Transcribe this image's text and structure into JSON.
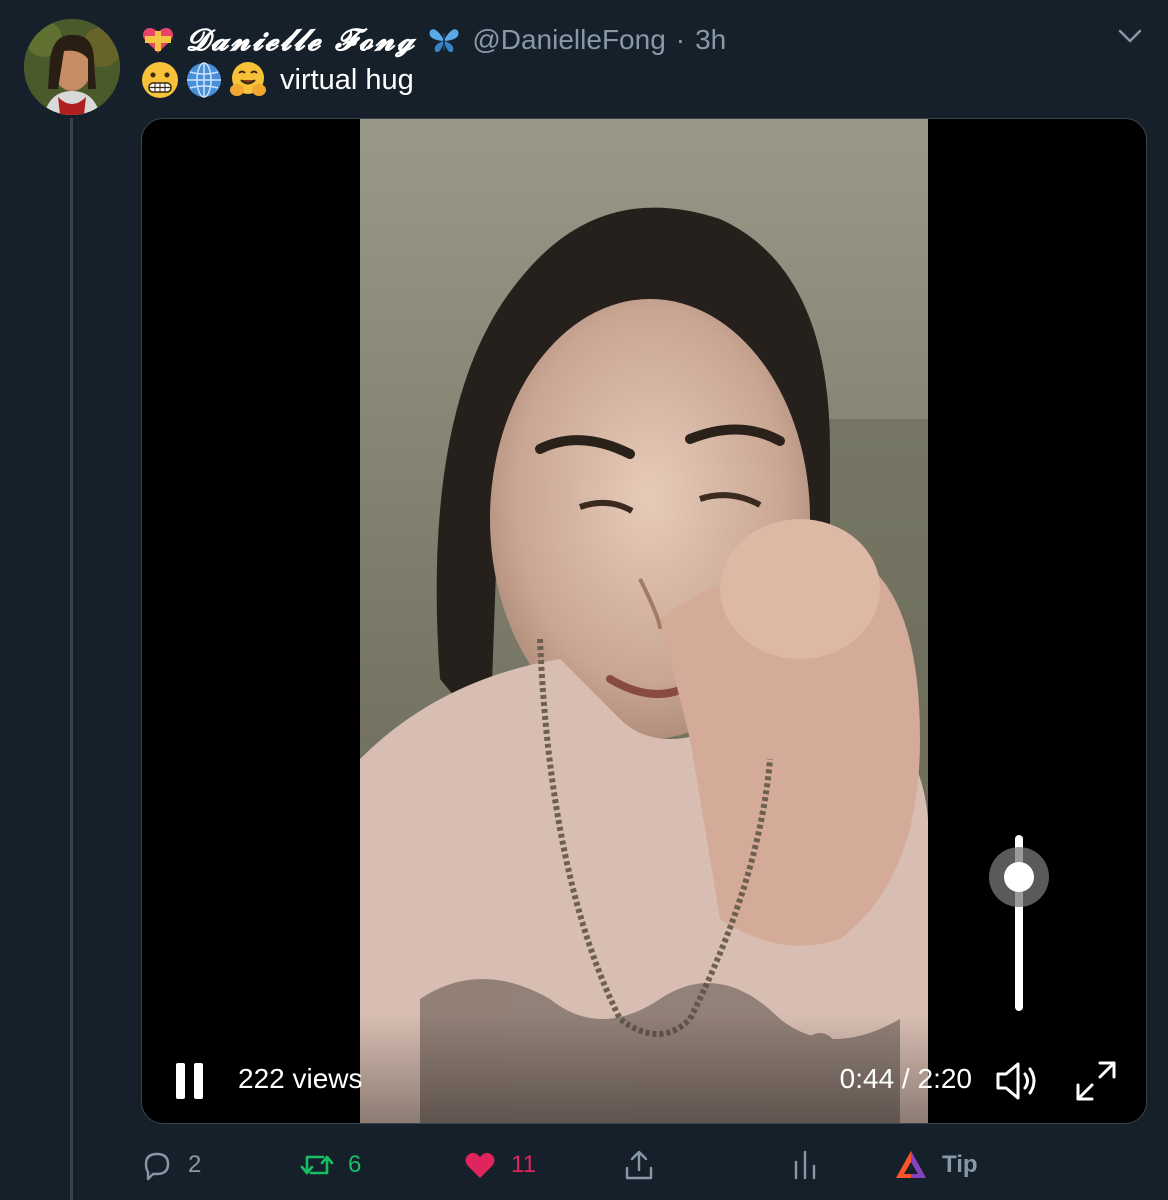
{
  "tweet": {
    "display_name": "𝓓𝓪𝓷𝓲𝓮𝓵𝓵𝓮 𝓕𝓸𝓷𝓰",
    "handle": "@DanielleFong",
    "separator": "·",
    "time": "3h",
    "text": "virtual hug",
    "emojis": [
      "grimacing-face",
      "globe-with-meridians",
      "hugging-face"
    ]
  },
  "video": {
    "views": "222 views",
    "time_readout": "0:44 / 2:20",
    "volume_level": 0.9,
    "state": "playing"
  },
  "actions": {
    "reply_count": "2",
    "retweet_count": "6",
    "like_count": "11",
    "tip_label": "Tip"
  },
  "colors": {
    "background": "#15202b",
    "muted": "#8899a6",
    "retweet": "#17bf63",
    "like": "#e0245e",
    "border": "#38444d"
  },
  "icons": [
    "heart-ribbon-icon",
    "butterfly-icon",
    "chevron-down-icon",
    "pause-icon",
    "volume-icon",
    "fullscreen-icon",
    "reply-icon",
    "retweet-icon",
    "like-icon",
    "share-icon",
    "analytics-icon",
    "tip-icon"
  ]
}
